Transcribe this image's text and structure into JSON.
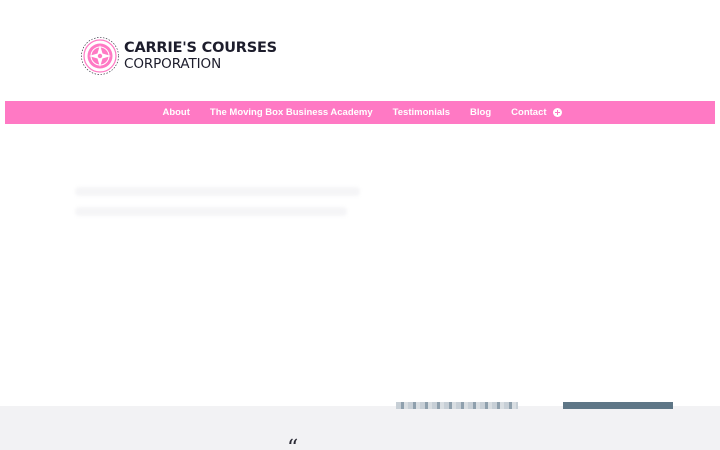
{
  "brand": {
    "name_line1": "CARRIE'S COURSES",
    "name_line2": "CORPORATION",
    "seal_words": [
      "GUIDANCE",
      "SUCCESS",
      "RESILIENCE"
    ],
    "primary_color": "#ff79c4",
    "text_color": "#1d1d2c"
  },
  "nav": {
    "items": [
      {
        "label": "About"
      },
      {
        "label": "The Moving Box Business Academy"
      },
      {
        "label": "Testimonials"
      },
      {
        "label": "Blog"
      },
      {
        "label": "Contact"
      }
    ],
    "contact_icon": "plus-circle-icon"
  },
  "testimonial": {
    "quote_glyph": "“"
  },
  "colors": {
    "nav_bg": "#ff79c4",
    "footer_band": "#f2f2f4"
  }
}
